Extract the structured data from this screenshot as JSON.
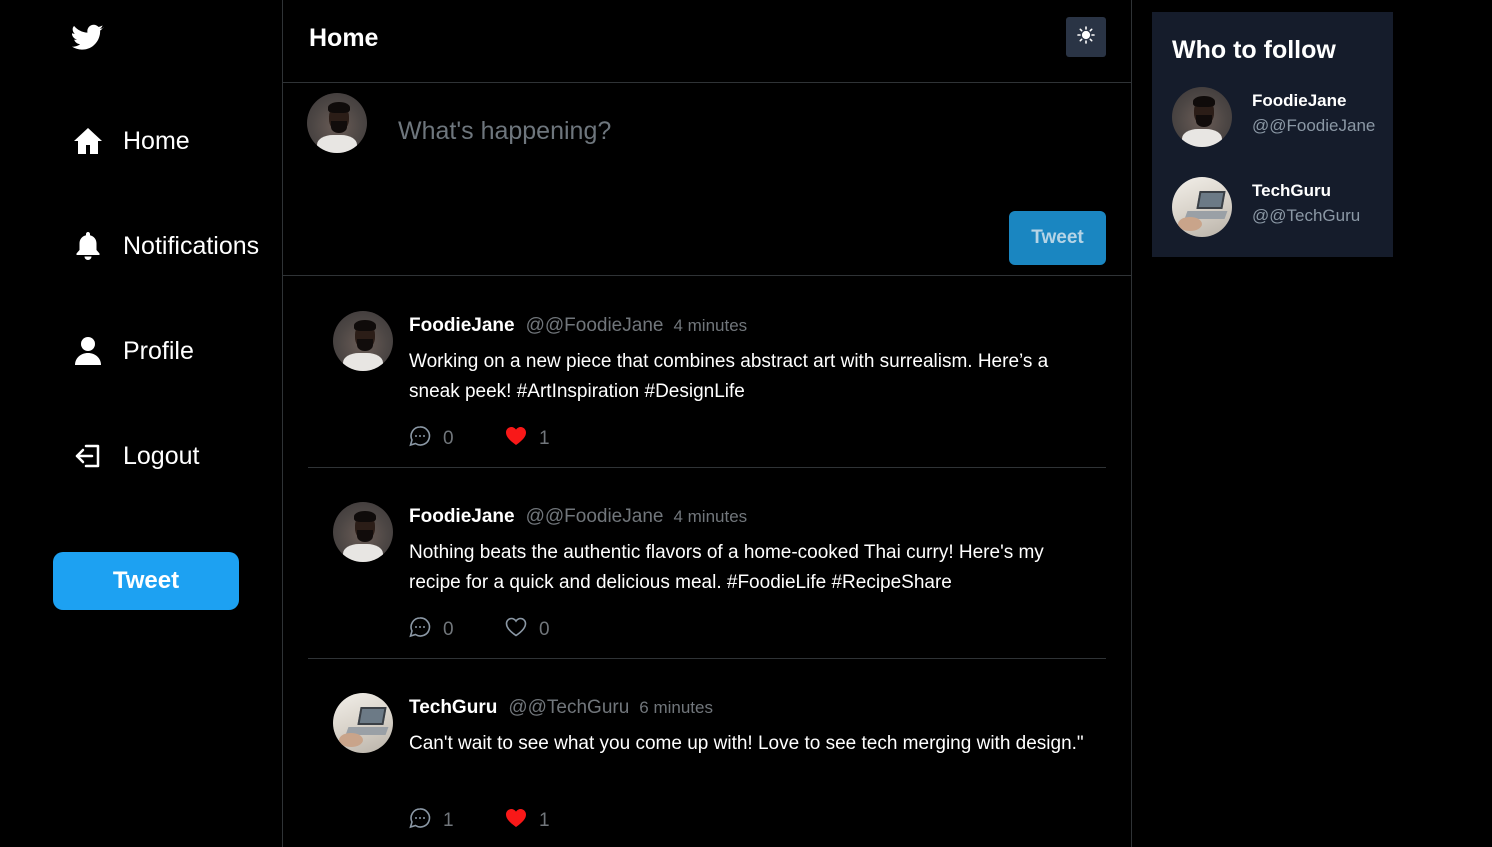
{
  "sidebar": {
    "logo_icon": "twitter-bird-icon",
    "items": [
      {
        "label": "Home",
        "icon": "home-icon"
      },
      {
        "label": "Notifications",
        "icon": "bell-icon"
      },
      {
        "label": "Profile",
        "icon": "user-icon"
      },
      {
        "label": "Logout",
        "icon": "logout-icon"
      }
    ],
    "tweet_button": "Tweet"
  },
  "header": {
    "title": "Home",
    "theme_icon": "sun-icon"
  },
  "composer": {
    "placeholder": "What's happening?",
    "tweet_button": "Tweet"
  },
  "feed": [
    {
      "name": "FoodieJane",
      "handle": "@@FoodieJane",
      "time": "4 minutes",
      "text": "Working on a new piece that combines abstract art with surrealism. Here’s a sneak peek! #ArtInspiration #DesignLife",
      "replies": "0",
      "likes": "1",
      "liked": true
    },
    {
      "name": "FoodieJane",
      "handle": "@@FoodieJane",
      "time": "4 minutes",
      "text": "Nothing beats the authentic flavors of a home-cooked Thai curry! Here's my recipe for a quick and delicious meal. #FoodieLife #RecipeShare",
      "replies": "0",
      "likes": "0",
      "liked": false
    },
    {
      "name": "TechGuru",
      "handle": "@@TechGuru",
      "time": "6 minutes",
      "text": "Can't wait to see what you come up with! Love to see tech merging with design.\"",
      "replies": "1",
      "likes": "1",
      "liked": true
    }
  ],
  "who_to_follow": {
    "title": "Who to follow",
    "users": [
      {
        "name": "FoodieJane",
        "handle": "@@FoodieJane"
      },
      {
        "name": "TechGuru",
        "handle": "@@TechGuru"
      }
    ]
  },
  "colors": {
    "accent": "#1da1f2",
    "liked": "#f91818",
    "card_bg": "#151c2b",
    "border": "#2f3336"
  }
}
